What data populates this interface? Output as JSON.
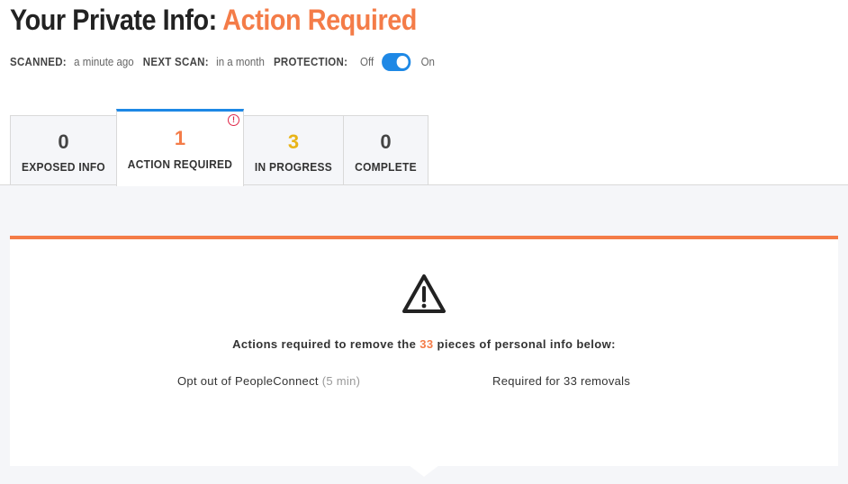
{
  "header": {
    "title_prefix": "Your Private Info:",
    "title_status": "Action Required"
  },
  "status": {
    "scanned_label": "SCANNED:",
    "scanned_value": "a minute ago",
    "next_scan_label": "NEXT SCAN:",
    "next_scan_value": "in a month",
    "protection_label": "PROTECTION:",
    "toggle_off_label": "Off",
    "toggle_on_label": "On",
    "protection_on": true
  },
  "tabs": [
    {
      "count": "0",
      "label": "EXPOSED INFO",
      "active": false
    },
    {
      "count": "1",
      "label": "ACTION REQUIRED",
      "active": true,
      "alert_badge": "!"
    },
    {
      "count": "3",
      "label": "IN PROGRESS",
      "active": false
    },
    {
      "count": "0",
      "label": "COMPLETE",
      "active": false
    }
  ],
  "card": {
    "headline_before": "Actions required to remove the",
    "headline_number": "33",
    "headline_after": "pieces of personal info below:",
    "optout_text": "Opt out of PeopleConnect",
    "optout_duration": "(5 min)",
    "required_text": "Required for 33 removals",
    "icon": "warning-triangle-icon"
  },
  "colors": {
    "accent_orange": "#f47c48",
    "accent_blue": "#1e88e5",
    "in_progress_yellow": "#e8b418",
    "alert_red": "#e0284a"
  }
}
